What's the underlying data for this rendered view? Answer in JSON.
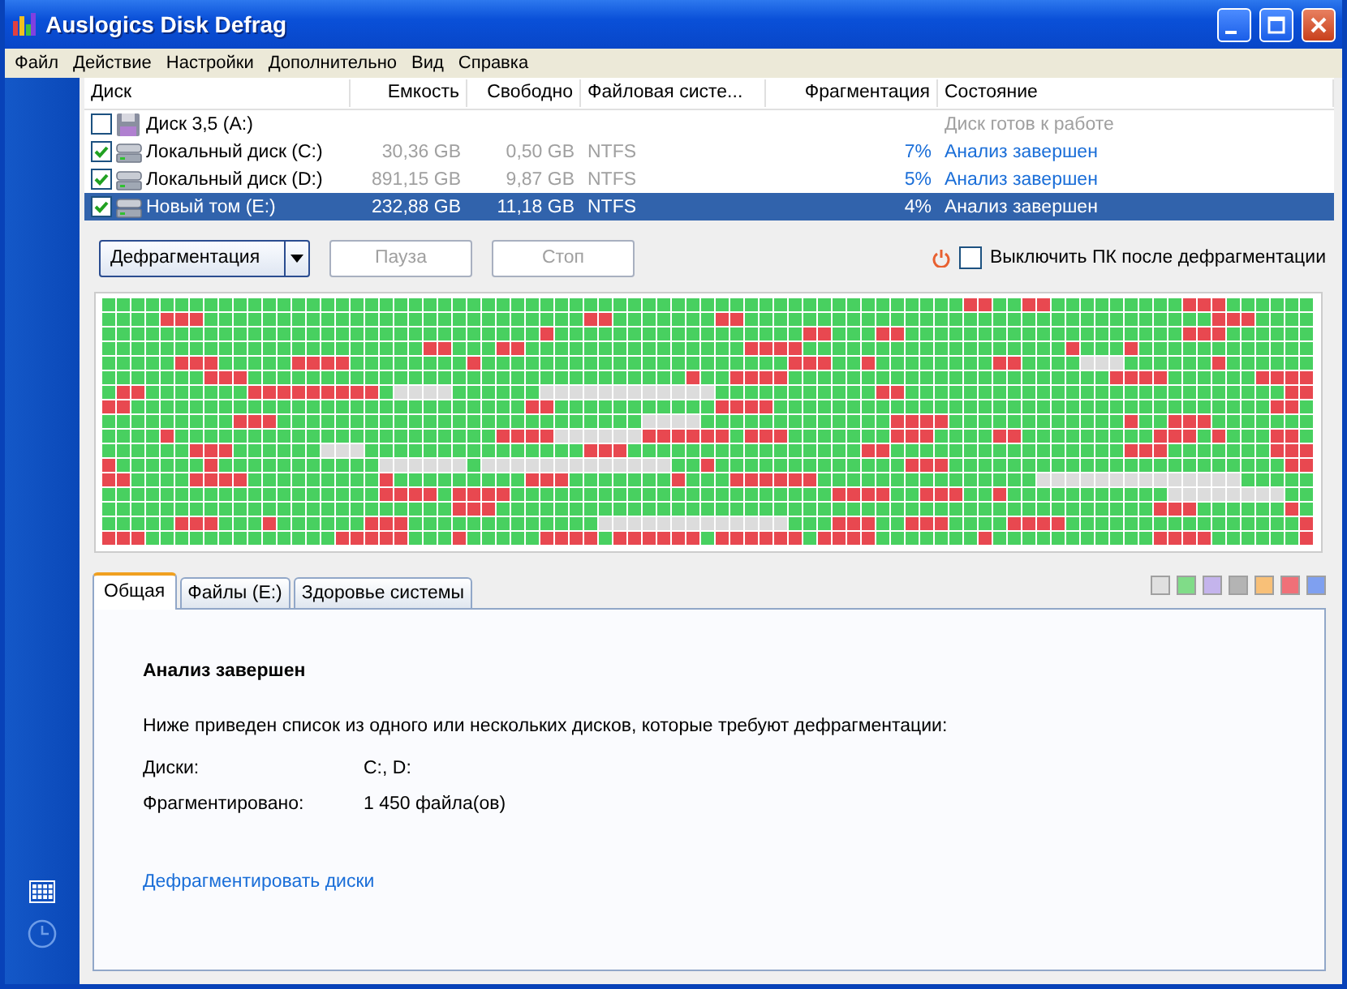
{
  "window": {
    "title": "Auslogics Disk Defrag"
  },
  "menu": [
    "Файл",
    "Действие",
    "Настройки",
    "Дополнительно",
    "Вид",
    "Справка"
  ],
  "disk_table": {
    "columns": [
      "Диск",
      "Емкость",
      "Свободно",
      "Файловая систе...",
      "Фрагментация",
      "Состояние"
    ],
    "rows": [
      {
        "kind": "floppy",
        "name": "Диск 3,5 (A:)",
        "capacity": "",
        "free": "",
        "fs": "",
        "fragmentation": "",
        "status": "Диск готов к работе",
        "checked": false,
        "selected": false,
        "ready": false
      },
      {
        "kind": "drive",
        "name": "Локальный диск (C:)",
        "capacity": "30,36 GB",
        "free": "0,50 GB",
        "fs": "NTFS",
        "fragmentation": "7%",
        "status": "Анализ завершен",
        "checked": true,
        "selected": false,
        "ready": true
      },
      {
        "kind": "drive",
        "name": "Локальный диск (D:)",
        "capacity": "891,15 GB",
        "free": "9,87 GB",
        "fs": "NTFS",
        "fragmentation": "5%",
        "status": "Анализ завершен",
        "checked": true,
        "selected": false,
        "ready": true
      },
      {
        "kind": "drive",
        "name": "Новый том (E:)",
        "capacity": "232,88 GB",
        "free": "11,18 GB",
        "fs": "NTFS",
        "fragmentation": "4%",
        "status": "Анализ завершен",
        "checked": true,
        "selected": true,
        "ready": true
      }
    ]
  },
  "toolbar": {
    "buttons": [
      {
        "label": "Дефрагментация",
        "disabled": false,
        "dropdown": true
      },
      {
        "label": "Пауза",
        "disabled": true,
        "dropdown": false
      },
      {
        "label": "Стоп",
        "disabled": true,
        "dropdown": false
      }
    ],
    "shutdown": {
      "label": "Выключить ПК после дефрагментации",
      "checked": false
    }
  },
  "tabs": [
    {
      "label": "Общая",
      "selected": true
    },
    {
      "label": "Файлы (E:)",
      "selected": false
    },
    {
      "label": "Здоровье системы",
      "selected": false
    }
  ],
  "legend": [
    {
      "color": "#e0e0e0"
    },
    {
      "color": "#80dc88"
    },
    {
      "color": "#c4b4ec"
    },
    {
      "color": "#b4b4b4"
    },
    {
      "color": "#f8c078"
    },
    {
      "color": "#f07078"
    },
    {
      "color": "#7fa0f0"
    }
  ],
  "panel": {
    "heading": "Анализ завершен",
    "text": "Ниже приведен список из одного или нескольких дисков, которые требуют дефрагментации:",
    "details": [
      {
        "label": "Диски:",
        "value": "C:, D:"
      },
      {
        "label": "Фрагментировано:",
        "value": "1 450 файла(ов)"
      }
    ],
    "link": "Дефрагментировать диски"
  }
}
